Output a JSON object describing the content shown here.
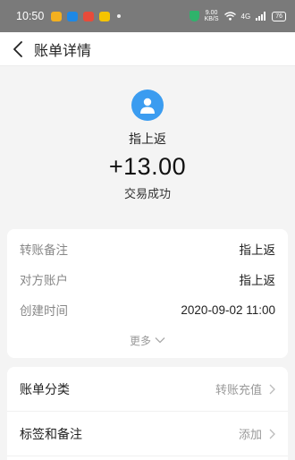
{
  "status_bar": {
    "time": "10:50",
    "speed_value": "9.00",
    "speed_unit": "KB/S",
    "signal_text": "4G",
    "battery": "76"
  },
  "header": {
    "title": "账单详情"
  },
  "summary": {
    "name": "指上返",
    "amount": "+13.00",
    "status": "交易成功"
  },
  "details": {
    "rows": [
      {
        "label": "转账备注",
        "value": "指上返"
      },
      {
        "label": "对方账户",
        "value": "指上返"
      },
      {
        "label": "创建时间",
        "value": "2020-09-02 11:00"
      }
    ],
    "more_label": "更多"
  },
  "options": {
    "rows": [
      {
        "label": "账单分类",
        "value": "转账充值"
      },
      {
        "label": "标签和备注",
        "value": "添加"
      }
    ]
  },
  "colors": {
    "status_bar": "#7a7a7a",
    "avatar": "#3b9cf0",
    "shield": "#2fb36b"
  }
}
